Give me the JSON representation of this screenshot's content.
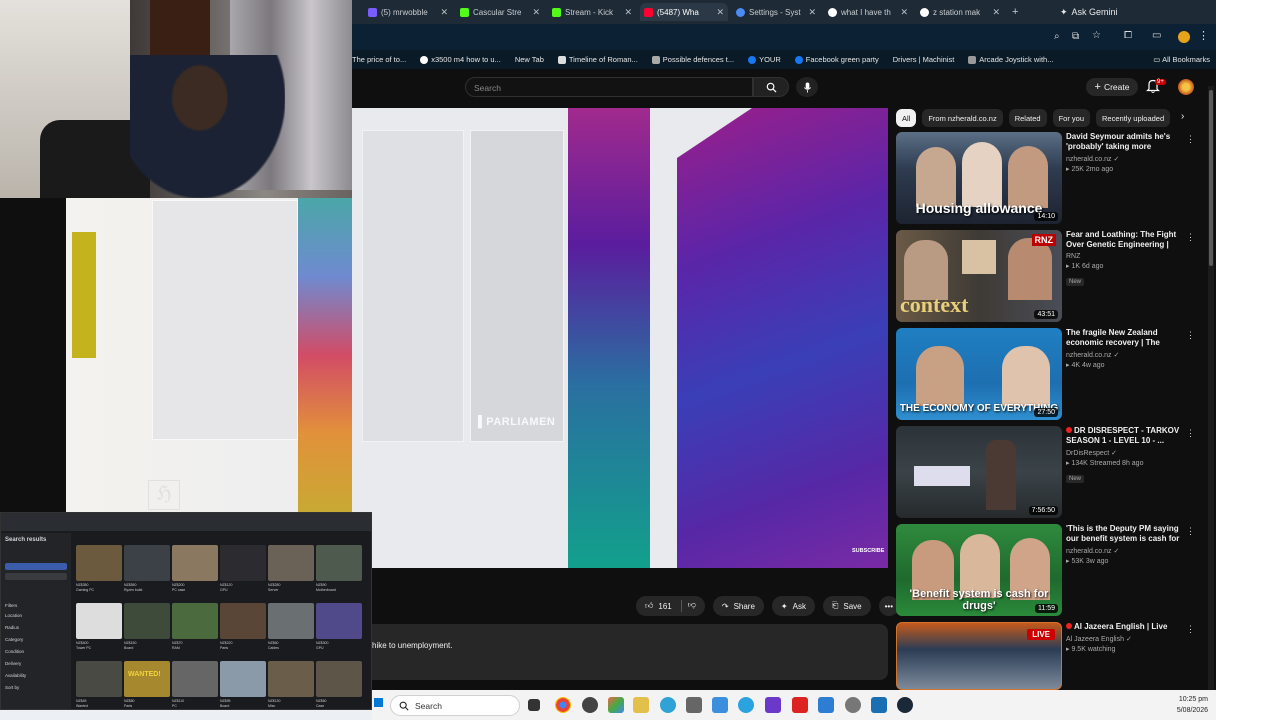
{
  "tabs": [
    {
      "label": "(5) mrwobble",
      "color": "#7b5cff"
    },
    {
      "label": "Cascular Stre",
      "color": "#53fc18"
    },
    {
      "label": "Stream - Kick",
      "color": "#53fc18"
    },
    {
      "label": "(5487) Wha",
      "color": "#ff0033"
    },
    {
      "label": "Settings - Syst",
      "color": "#4c8bf5"
    },
    {
      "label": "what I have th",
      "color": "#ffffff"
    },
    {
      "label": "z station mak",
      "color": "#ffffff"
    }
  ],
  "gemini_label": "Ask Gemini",
  "bookmarks": [
    "The price of to...",
    "x3500 m4 how to u...",
    "New Tab",
    "Timeline of Roman...",
    "Possible defences t...",
    "YOUR",
    "Facebook green party",
    "Drivers | Machinist",
    "Arcade Joystick with..."
  ],
  "all_bookmarks": "All Bookmarks",
  "search_placeholder": "Search",
  "create_label": "Create",
  "notif_count": "9+",
  "video_overlay": "PARLIAMEN",
  "subscribe_text": "SUBSCRIBE",
  "actions": {
    "likes": "161",
    "share": "Share",
    "ask": "Ask",
    "save": "Save"
  },
  "description": "hike to unemployment.",
  "chips": [
    "All",
    "From nzherald.co.nz",
    "Related",
    "For you",
    "Recently uploaded"
  ],
  "recommendations": [
    {
      "title": "David Seymour admits he's 'probably' taking more housing ...",
      "channel": "nzherald.co.nz",
      "stats": "25K  2mo ago",
      "duration": "14:10",
      "thumb_text": "Housing allowance",
      "new": "",
      "live": "",
      "prefix": ""
    },
    {
      "title": "Fear and Loathing: The Fight Over Genetic Engineering | Context",
      "channel": "RNZ",
      "stats": "1K  6d ago",
      "duration": "43:51",
      "thumb_text": "context",
      "new": "New",
      "live": "",
      "prefix": ""
    },
    {
      "title": "The fragile New Zealand economic recovery | The Economy of ...",
      "channel": "nzherald.co.nz",
      "stats": "4K  4w ago",
      "duration": "27:50",
      "thumb_text": "THE ECONOMY OF EVERYTHING",
      "new": "",
      "live": "",
      "prefix": ""
    },
    {
      "title": "DR DISRESPECT - TARKOV SEASON 1 - LEVEL 10 - ...",
      "channel": "DrDisRespect",
      "stats": "134K  Streamed 8h ago",
      "duration": "7:56:50",
      "thumb_text": "",
      "new": "New",
      "live": "",
      "prefix": "red"
    },
    {
      "title": "'This is the Deputy PM saying our benefit system is cash for drugs' |...",
      "channel": "nzherald.co.nz",
      "stats": "53K  3w ago",
      "duration": "11:59",
      "thumb_text": "'Benefit system is cash for drugs'",
      "new": "",
      "live": "",
      "prefix": ""
    },
    {
      "title": "Al Jazeera English | Live",
      "channel": "Al Jazeera English",
      "stats": "9.5K watching",
      "duration": "",
      "thumb_text": "",
      "new": "",
      "live": "LIVE",
      "prefix": "red"
    }
  ],
  "mini": {
    "heading": "Search results",
    "side_items": [
      "Filters",
      "Location",
      "Radius",
      "Category",
      "Condition",
      "Delivery",
      "Availability",
      "Sort by"
    ],
    "cards": [
      {
        "price": "NZ$350",
        "title": "Gaming PC"
      },
      {
        "price": "NZ$550",
        "title": "Ryzen build"
      },
      {
        "price": "NZ$200",
        "title": "PC case"
      },
      {
        "price": "NZ$120",
        "title": "GPU"
      },
      {
        "price": "NZ$280",
        "title": "Server"
      },
      {
        "price": "NZ$90",
        "title": "Motherboard"
      },
      {
        "price": "NZ$400",
        "title": "Tower PC"
      },
      {
        "price": "NZ$150",
        "title": "Board"
      },
      {
        "price": "NZ$70",
        "title": "RAM"
      },
      {
        "price": "NZ$220",
        "title": "Parts"
      },
      {
        "price": "NZ$60",
        "title": "Cables"
      },
      {
        "price": "NZ$300",
        "title": "GPU"
      },
      {
        "price": "NZ$45",
        "title": "Wanted"
      },
      {
        "price": "NZ$80",
        "title": "Parts"
      },
      {
        "price": "NZ$110",
        "title": "PC"
      },
      {
        "price": "NZ$95",
        "title": "Board"
      },
      {
        "price": "NZ$130",
        "title": "Misc"
      },
      {
        "price": "NZ$60",
        "title": "Case"
      }
    ],
    "wanted_text": "WANTED!"
  },
  "taskbar_search": "Search",
  "clock": {
    "time": "10:25 pm",
    "date": "5/08/2026"
  }
}
